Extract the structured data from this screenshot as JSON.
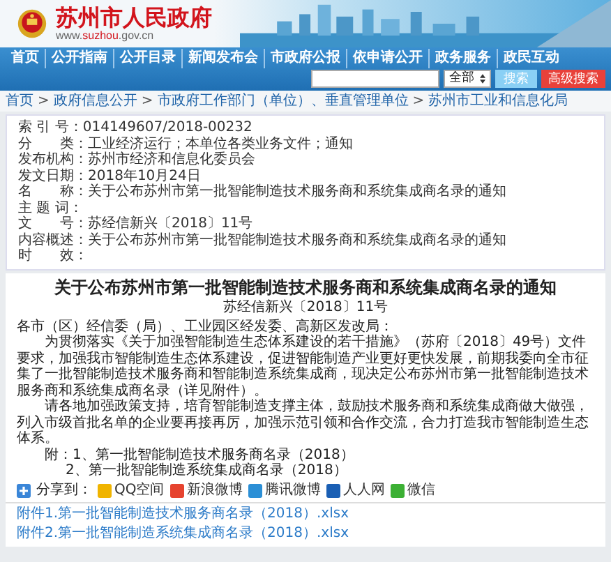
{
  "header": {
    "title": "苏州市人民政府",
    "url": [
      {
        "text": "www.",
        "highlight": false
      },
      {
        "text": "suzhou",
        "highlight": true
      },
      {
        "text": ".gov.cn",
        "highlight": false
      }
    ]
  },
  "nav": {
    "items": [
      {
        "label": "首页"
      },
      {
        "label": "公开指南"
      },
      {
        "label": "公开目录"
      },
      {
        "label": "新闻发布会"
      },
      {
        "label": "市政府公报"
      },
      {
        "label": "依申请公开"
      },
      {
        "label": "政务服务"
      },
      {
        "label": "政民互动"
      }
    ],
    "search": {
      "scope": "全部",
      "button": "搜索",
      "advanced": "高级搜索"
    }
  },
  "breadcrumb": {
    "separator": ">",
    "items": [
      "首页",
      "政府信息公开",
      "市政府工作部门（单位）、垂直管理单位",
      "苏州市工业和信息化局"
    ]
  },
  "meta": [
    {
      "label": "索 引 号：",
      "value": "014149607/2018-00232"
    },
    {
      "label": "分　　类：",
      "value": "工业经济运行；本单位各类业务文件；通知"
    },
    {
      "label": "发布机构：",
      "value": "苏州市经济和信息化委员会"
    },
    {
      "label": "发文日期：",
      "value": "2018年10月24日"
    },
    {
      "label": "名　　称：",
      "value": "关于公布苏州市第一批智能制造技术服务商和系统集成商名录的通知"
    },
    {
      "label": "主 题 词："
    },
    {
      "label": "文　　号：",
      "value": "苏经信新兴〔2018〕11号"
    },
    {
      "label": "内容概述：",
      "value": "关于公布苏州市第一批智能制造技术服务商和系统集成商名录的通知"
    },
    {
      "label": "时　　效："
    }
  ],
  "article": {
    "title": "关于公布苏州市第一批智能制造技术服务商和系统集成商名录的通知",
    "doc_number": "苏经信新兴〔2018〕11号",
    "addressee": "各市（区）经信委（局）、工业园区经发委、高新区发改局：",
    "paragraphs": [
      "为贯彻落实《关于加强智能制造生态体系建设的若干措施》（苏府〔2018〕49号）文件要求，加强我市智能制造生态体系建设，促进智能制造产业更好更快发展，前期我委向全市征集了一批智能制造技术服务商和智能制造系统集成商，现决定公布苏州市第一批智能制造技术服务商和系统集成商名录（详见附件）。",
      "请各地加强政策支持，培育智能制造支撑主体，鼓励技术服务商和系统集成商做大做强，列入市级首批名单的企业要再接再厉，加强示范引领和合作交流，合力打造我市智能制造生态体系。"
    ],
    "annex": [
      "附：1、第一批智能制造技术服务商名录（2018）",
      "2、第一批智能制造系统集成商名录（2018）"
    ],
    "share": {
      "label": "分享到：",
      "targets": [
        {
          "label": "QQ空间",
          "color": "#f0b400"
        },
        {
          "label": "新浪微博",
          "color": "#e6432f"
        },
        {
          "label": "腾讯微博",
          "color": "#2b8fd6"
        },
        {
          "label": "人人网",
          "color": "#1a5fb4"
        },
        {
          "label": "微信",
          "color": "#3cb034"
        }
      ]
    }
  },
  "attachments": [
    "附件1.第一批智能制造技术服务商名录（2018）.xlsx",
    "附件2.第一批智能制造系统集成商名录（2018）.xlsx"
  ]
}
